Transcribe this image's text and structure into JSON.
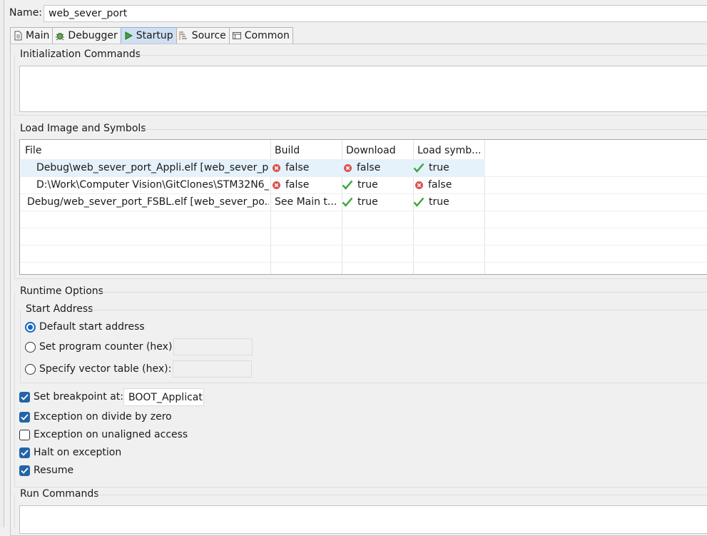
{
  "name_field": {
    "label": "Name:",
    "value": "web_sever_port"
  },
  "tabs": [
    {
      "label": "Main",
      "icon": "document-icon"
    },
    {
      "label": "Debugger",
      "icon": "bug-icon"
    },
    {
      "label": "Startup",
      "icon": "play-icon",
      "active": true
    },
    {
      "label": "Source",
      "icon": "source-icon"
    },
    {
      "label": "Common",
      "icon": "window-icon"
    }
  ],
  "init_commands": {
    "title": "Initialization Commands",
    "value": ""
  },
  "load_image": {
    "title": "Load Image and Symbols",
    "columns": [
      "File",
      "Build",
      "Download",
      "Load symb..."
    ],
    "rows": [
      {
        "file": "Debug\\web_sever_port_Appli.elf [web_sever_p...",
        "build": "false",
        "build_status": "error",
        "download": "false",
        "download_status": "error",
        "symbols": "true",
        "symbols_status": "ok",
        "selected": true,
        "run": false
      },
      {
        "file": "D:\\Work\\Computer Vision\\GitClones\\STM32N6_...",
        "build": "false",
        "build_status": "error",
        "download": "true",
        "download_status": "ok",
        "symbols": "false",
        "symbols_status": "error",
        "selected": false,
        "run": false
      },
      {
        "file": "Debug/web_sever_port_FSBL.elf [web_sever_po...",
        "build": "See Main t...",
        "build_status": "none",
        "download": "true",
        "download_status": "ok",
        "symbols": "true",
        "symbols_status": "ok",
        "selected": false,
        "run": true
      }
    ]
  },
  "runtime": {
    "title": "Runtime Options",
    "start_address": {
      "title": "Start Address",
      "default_label": "Default start address",
      "pc_label": "Set program counter (hex):",
      "vector_label": "Specify vector table (hex):",
      "pc_value": "",
      "vector_value": ""
    },
    "breakpoint": {
      "label": "Set breakpoint at:",
      "value": "BOOT_Applicati",
      "checked": true
    },
    "divide_by_zero": {
      "label": "Exception on divide by zero",
      "checked": true
    },
    "unaligned": {
      "label": "Exception on unaligned access",
      "checked": false
    },
    "halt": {
      "label": "Halt on exception",
      "checked": true
    },
    "resume": {
      "label": "Resume",
      "checked": true
    }
  },
  "run_commands": {
    "title": "Run Commands",
    "value": ""
  },
  "colors": {
    "accent": "#2364a8",
    "selection": "#e5f1fb",
    "error": "#d9534f",
    "ok": "#3aa635"
  }
}
